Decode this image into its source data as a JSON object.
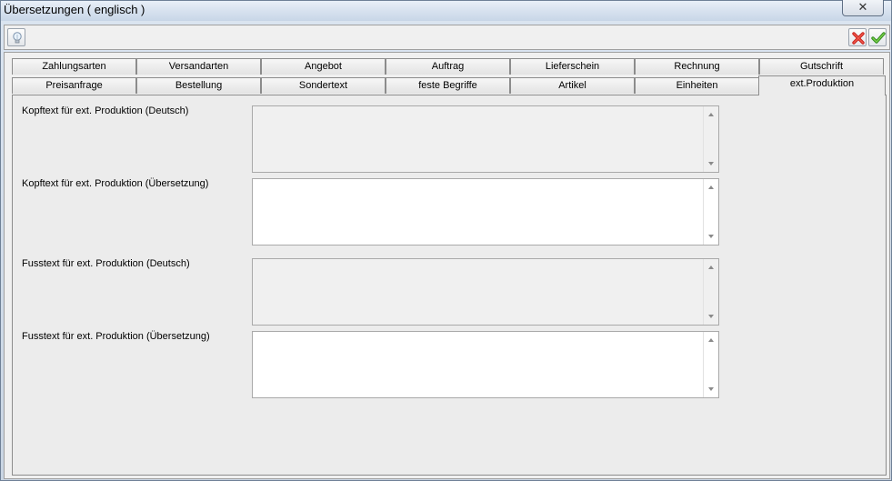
{
  "window": {
    "title": "Übersetzungen ( englisch )",
    "close_symbol": "✕"
  },
  "toolbar": {
    "hint_icon": "lightbulb-icon",
    "cancel_icon": "red-x-icon",
    "confirm_icon": "green-check-icon"
  },
  "tabs": {
    "row1": [
      "Zahlungsarten",
      "Versandarten",
      "Angebot",
      "Auftrag",
      "Lieferschein",
      "Rechnung",
      "Gutschrift"
    ],
    "row2": [
      "Preisanfrage",
      "Bestellung",
      "Sondertext",
      "feste Begriffe",
      "Artikel",
      "Einheiten",
      "ext.Produktion"
    ],
    "active": "ext.Produktion"
  },
  "fields": [
    {
      "label": "Kopftext für ext. Produktion (Deutsch)",
      "value": "",
      "readonly": true
    },
    {
      "label": "Kopftext für ext. Produktion (Übersetzung)",
      "value": "",
      "readonly": false
    },
    {
      "label": "Fusstext für ext. Produktion (Deutsch)",
      "value": "",
      "readonly": true
    },
    {
      "label": "Fusstext für ext. Produktion (Übersetzung)",
      "value": "",
      "readonly": false
    }
  ]
}
